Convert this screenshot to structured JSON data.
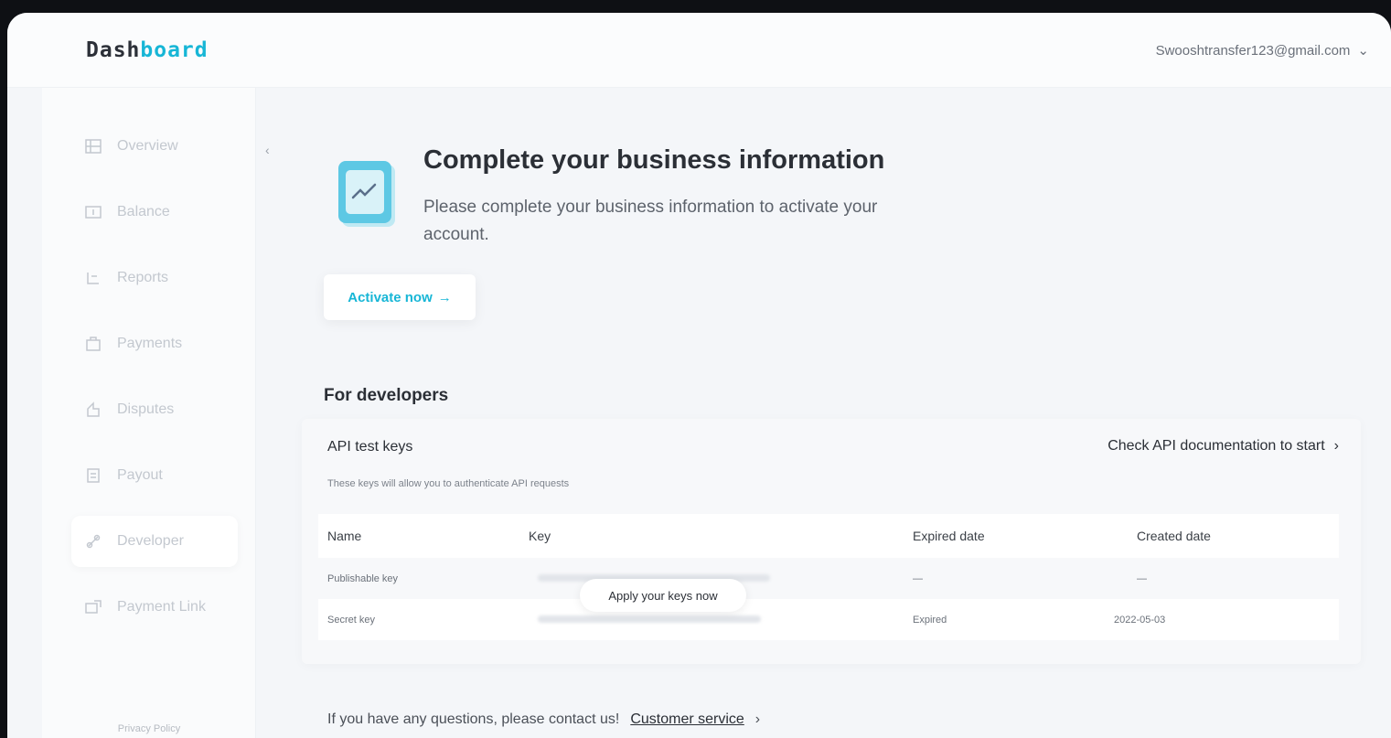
{
  "header": {
    "logo_part1": "Dash",
    "logo_part2": "board",
    "account_email": "Swooshtransfer123@gmail.com",
    "account_chevron": "⌄"
  },
  "sidebar": {
    "collapse_glyph": "‹",
    "items": [
      {
        "label": "Overview",
        "icon": "grid-icon"
      },
      {
        "label": "Balance",
        "icon": "wallet-icon"
      },
      {
        "label": "Reports",
        "icon": "report-icon"
      },
      {
        "label": "Payments",
        "icon": "payment-icon"
      },
      {
        "label": "Disputes",
        "icon": "dispute-icon"
      },
      {
        "label": "Payout",
        "icon": "payout-icon"
      },
      {
        "label": "Developer",
        "icon": "developer-icon",
        "active": true
      },
      {
        "label": "Payment Link",
        "icon": "link-icon"
      }
    ],
    "privacy_label": "Privacy Policy"
  },
  "banner": {
    "title": "Complete your business information",
    "subtitle": "Please complete your business information to activate your account.",
    "activate_label": "Activate now",
    "activate_arrow": "→"
  },
  "developers": {
    "section_title": "For developers",
    "api_title": "API test keys",
    "doc_link": "Check API documentation to start",
    "doc_link_arrow": "›",
    "description": "These keys will allow you to authenticate API requests",
    "columns": [
      "Name",
      "Key",
      "Expired date",
      "Created date"
    ],
    "rows": [
      {
        "name": "Publishable key",
        "expired": "—",
        "created": "—"
      },
      {
        "name": "Secret key",
        "expired": "Expired",
        "created": "2022-05-03"
      }
    ],
    "apply_label": "Apply your keys now"
  },
  "footer": {
    "text": "If you have any questions, please contact us!",
    "link": "Customer service",
    "link_arrow": "›"
  },
  "colors": {
    "accent": "#17b6d6",
    "background": "#f4f6f9"
  }
}
